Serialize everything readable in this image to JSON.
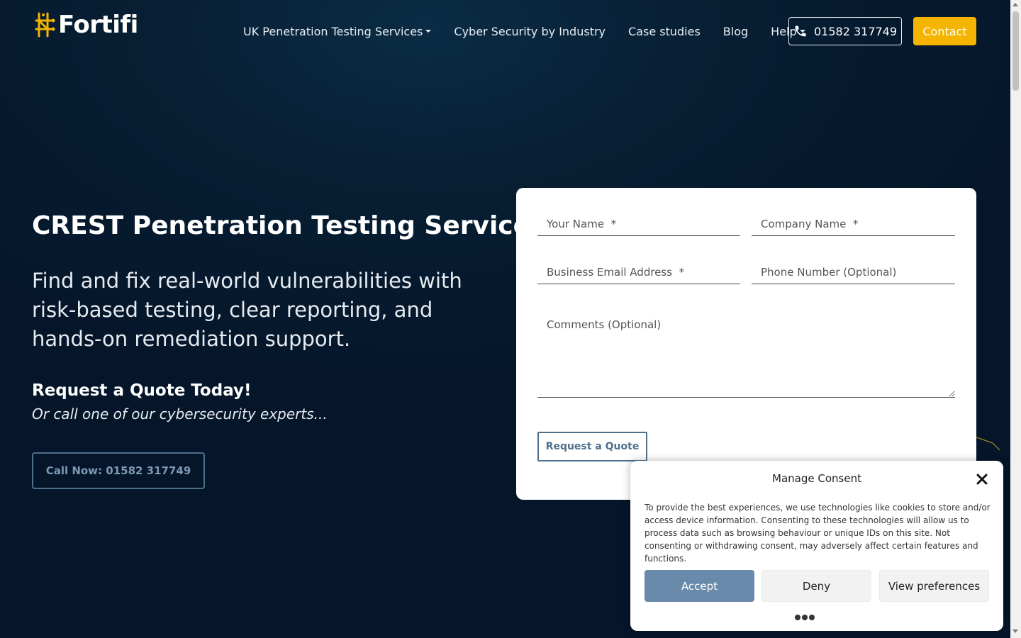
{
  "brand": {
    "name": "Fortifi",
    "accent_color": "#f5b400",
    "bg_color": "#071e33"
  },
  "nav": {
    "items": [
      {
        "label": "UK Penetration Testing Services",
        "has_dropdown": true
      },
      {
        "label": "Cyber Security by Industry",
        "has_dropdown": false
      },
      {
        "label": "Case studies",
        "has_dropdown": false
      },
      {
        "label": "Blog",
        "has_dropdown": false
      },
      {
        "label": "Help",
        "has_dropdown": true
      }
    ],
    "phone_label": "01582 317749",
    "phone_icon": "phone-icon",
    "contact_label": "Contact"
  },
  "hero": {
    "title": "CREST Penetration Testing Services",
    "subtitle": "Find and fix real-world vulnerabilities with risk-based testing, clear reporting, and hands-on remediation support.",
    "quote_heading": "Request a Quote Today!",
    "quote_sub": "Or call one of our cybersecurity experts...",
    "call_button": "Call Now: 01582 317749"
  },
  "form": {
    "name_placeholder": "Your Name  *",
    "company_placeholder": "Company Name  *",
    "email_placeholder": "Business Email Address  *",
    "phone_placeholder": "Phone Number (Optional)",
    "comments_placeholder": "Comments (Optional)",
    "submit_label": "Request a Quote"
  },
  "consent": {
    "title": "Manage Consent",
    "close_icon": "close-icon",
    "text": "To provide the best experiences, we use technologies like cookies to store and/or access device information. Consenting to these technologies will allow us to process data such as browsing behaviour or unique IDs on this site. Not consenting or withdrawing consent, may adversely affect certain features and functions.",
    "accept_label": "Accept",
    "deny_label": "Deny",
    "prefs_label": "View preferences"
  }
}
